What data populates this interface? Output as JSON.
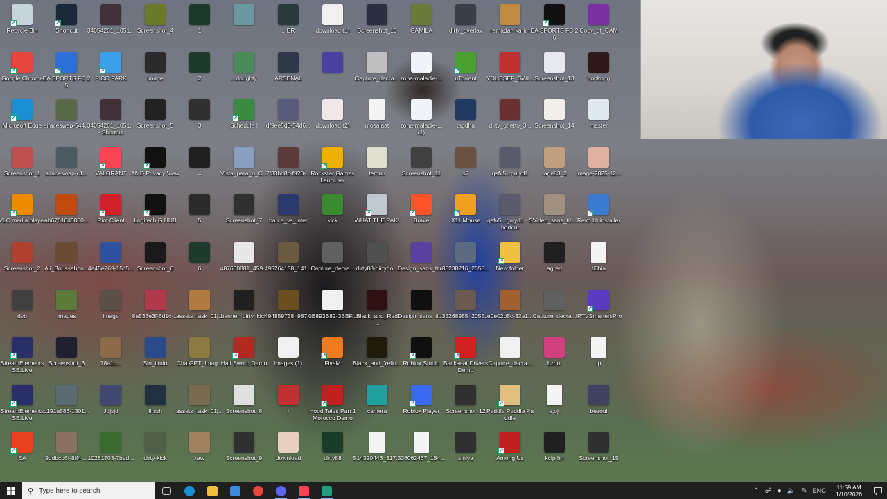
{
  "desktop": {
    "columns": [
      [
        {
          "label": "Recycle Bin",
          "icon": "recycle-bin-icon",
          "color": "#c8d4dc"
        },
        {
          "label": "Google Chrome",
          "icon": "chrome-icon",
          "color": "#e8453c"
        },
        {
          "label": "Microsoft Edge",
          "icon": "edge-icon",
          "color": "#1b8fd4"
        },
        {
          "label": "Screenshot_1",
          "icon": "image-icon",
          "color": "#c05050"
        },
        {
          "label": "VLC media player",
          "icon": "vlc-icon",
          "color": "#f08a00"
        },
        {
          "label": "Screenshot_2",
          "icon": "image-icon",
          "color": "#b04030"
        },
        {
          "label": "dvb",
          "icon": "image-icon",
          "color": "#404040"
        },
        {
          "label": "StreamElements SE.Live",
          "icon": "streamelements-icon",
          "color": "#2a2f6a"
        },
        {
          "label": "StreamElements SE.Live",
          "icon": "streamelements-icon",
          "color": "#2a2f6a"
        },
        {
          "label": "EA",
          "icon": "ea-icon",
          "color": "#e8411e"
        }
      ],
      [
        {
          "label": "Shortcut",
          "icon": "steam-icon",
          "color": "#1b2838"
        },
        {
          "label": "EA SPORTS FC 25",
          "icon": "eafc-icon",
          "color": "#2c6fd6"
        },
        {
          "label": "aifaceswap-544...",
          "icon": "image-icon",
          "color": "#5a6a48"
        },
        {
          "label": "aifaceswap-c1...",
          "icon": "image-icon",
          "color": "#4a5a60"
        },
        {
          "label": "ab67616d0000...",
          "icon": "image-icon",
          "color": "#c04a10"
        },
        {
          "label": "Ali_Boussabou...",
          "icon": "image-icon",
          "color": "#6a4a30"
        },
        {
          "label": "images",
          "icon": "image-icon",
          "color": "#5c7a3a"
        },
        {
          "label": "Screenshot_3",
          "icon": "image-icon",
          "color": "#202030"
        },
        {
          "label": "c191a586-1301...",
          "icon": "image-icon",
          "color": "#5a6a70"
        },
        {
          "label": "9ddbcb6f-8ff4-...",
          "icon": "image-icon",
          "color": "#8a7060"
        }
      ],
      [
        {
          "label": "34054261_1051...",
          "icon": "image-icon",
          "color": "#403038"
        },
        {
          "label": "PICO PARK",
          "icon": "picopark-icon",
          "color": "#3aa0e8"
        },
        {
          "label": "34054261_1051... - Shortcut",
          "icon": "image-icon",
          "color": "#403038"
        },
        {
          "label": "VALORANT",
          "icon": "valorant-icon",
          "color": "#fa4454"
        },
        {
          "label": "Riot Client",
          "icon": "riot-icon",
          "color": "#d0202a"
        },
        {
          "label": "4a45e769-15c5...",
          "icon": "image-icon",
          "color": "#3050a0"
        },
        {
          "label": "image",
          "icon": "image-icon",
          "color": "#5a5048"
        },
        {
          "label": "78a1c...",
          "icon": "image-icon",
          "color": "#8a6a4a"
        },
        {
          "label": "Jdjsjd",
          "icon": "image-icon",
          "color": "#404870"
        },
        {
          "label": "10281703-7bad...",
          "icon": "image-icon",
          "color": "#3a6a30"
        }
      ],
      [
        {
          "label": "Screenshot_4",
          "icon": "image-icon",
          "color": "#6a7a2a"
        },
        {
          "label": "image",
          "icon": "image-icon",
          "color": "#2a2a2a"
        },
        {
          "label": "Screenshot_5",
          "icon": "image-icon",
          "color": "#222222"
        },
        {
          "label": "AMD Privacy View",
          "icon": "amd-icon",
          "color": "#111111"
        },
        {
          "label": "Logitech G HUB",
          "icon": "logitech-icon",
          "color": "#111111"
        },
        {
          "label": "Screenshot_6",
          "icon": "image-icon",
          "color": "#1a1a1a"
        },
        {
          "label": "8a533e3f-6d1c-...",
          "icon": "image-icon",
          "color": "#b03a4a"
        },
        {
          "label": "Sin_titulo",
          "icon": "image-icon",
          "color": "#2a4a8a"
        },
        {
          "label": "finish",
          "icon": "image-icon",
          "color": "#203040"
        },
        {
          "label": "dirty-kick",
          "icon": "image-icon",
          "color": "#506048"
        }
      ],
      [
        {
          "label": "1",
          "icon": "image-icon",
          "color": "#1c3a2a"
        },
        {
          "label": "2",
          "icon": "image-icon",
          "color": "#1c3a2a"
        },
        {
          "label": "3",
          "icon": "image-icon",
          "color": "#303030"
        },
        {
          "label": "4",
          "icon": "image-icon",
          "color": "#202020"
        },
        {
          "label": "5",
          "icon": "image-icon",
          "color": "#2a2a2a"
        },
        {
          "label": "6",
          "icon": "image-icon",
          "color": "#1e3a2a"
        },
        {
          "label": "assets_task_01j...",
          "icon": "image-icon",
          "color": "#b07a40"
        },
        {
          "label": "ChatGPT_Imag...",
          "icon": "image-icon",
          "color": "#8a7a40"
        },
        {
          "label": "assets_task_01j...",
          "icon": "image-icon",
          "color": "#7a6a50"
        },
        {
          "label": "raw",
          "icon": "image-icon",
          "color": "#a08060"
        }
      ],
      [
        {
          "label": "",
          "icon": "image-icon",
          "color": "#6a9aa0"
        },
        {
          "label": "...doughty",
          "icon": "image-icon",
          "color": "#4a8a5a"
        },
        {
          "label": "Schedule I",
          "icon": "schedule-icon",
          "color": "#3a8a40"
        },
        {
          "label": "Vista_para_o_C...",
          "icon": "image-icon",
          "color": "#8aa0c0"
        },
        {
          "label": "Screenshot_7",
          "icon": "image-icon",
          "color": "#303030"
        },
        {
          "label": "487600881_459...",
          "icon": "image-icon",
          "color": "#e8e8e8"
        },
        {
          "label": "banner_dirty_kick",
          "icon": "image-icon",
          "color": "#202020"
        },
        {
          "label": "Half Sword Demo",
          "icon": "halfsword-icon",
          "color": "#b02a20"
        },
        {
          "label": "Screenshot_8",
          "icon": "image-icon",
          "color": "#e0e0e0"
        },
        {
          "label": "Screenshot_9",
          "icon": "image-icon",
          "color": "#303030"
        }
      ],
      [
        {
          "label": "...ER",
          "icon": "image-icon",
          "color": "#2a3a3a"
        },
        {
          "label": "ARSENAL",
          "icon": "image-icon",
          "color": "#303848"
        },
        {
          "label": "df9ee5d5-54d6...",
          "icon": "image-icon",
          "color": "#5a5a7a"
        },
        {
          "label": "7f33bd8c-f920-...",
          "icon": "image-icon",
          "color": "#5a3a3a"
        },
        {
          "label": "barca_vs_inter",
          "icon": "image-icon",
          "color": "#2a3a6a"
        },
        {
          "label": "495264158_141...",
          "icon": "image-icon",
          "color": "#6a5a40"
        },
        {
          "label": "494859738_987...",
          "icon": "image-icon",
          "color": "#6a5020"
        },
        {
          "label": "images (1)",
          "icon": "image-icon",
          "color": "#f0f0f0"
        },
        {
          "label": "i",
          "icon": "image-icon",
          "color": "#c03030"
        },
        {
          "label": "download",
          "icon": "image-icon",
          "color": "#e8d0c0"
        }
      ],
      [
        {
          "label": "download (1)",
          "icon": "image-icon",
          "color": "#f0f0f0"
        },
        {
          "label": "",
          "icon": "image-icon",
          "color": "#4a40a0"
        },
        {
          "label": "download (2)",
          "icon": "image-icon",
          "color": "#f0e8e8"
        },
        {
          "label": "Rockstar Games Launcher",
          "icon": "rockstar-icon",
          "color": "#f0b000"
        },
        {
          "label": "kick",
          "icon": "image-icon",
          "color": "#3a8a30"
        },
        {
          "label": "Capture_decra...",
          "icon": "image-icon",
          "color": "#606060"
        },
        {
          "label": "0B893B82-3BBF...",
          "icon": "image-icon",
          "color": "#f0f0f0"
        },
        {
          "label": "FiveM",
          "icon": "fivem-icon",
          "color": "#f07a20"
        },
        {
          "label": "Hood Tales Part 1 Morocco Demo",
          "icon": "hoodtales-icon",
          "color": "#c02020"
        },
        {
          "label": "dirty88",
          "icon": "image-icon",
          "color": "#1a3a2a"
        }
      ],
      [
        {
          "label": "Screenshot_10",
          "icon": "image-icon",
          "color": "#2a3040"
        },
        {
          "label": "Capture_decra...",
          "icon": "image-icon",
          "color": "#c0c0c0"
        },
        {
          "label": "mosalaat",
          "icon": "file-icon",
          "color": "#f4f4f4"
        },
        {
          "label": "temuu",
          "icon": "image-icon",
          "color": "#e0e0d0"
        },
        {
          "label": "WHAT THE PAK!",
          "icon": "whatthepak-icon",
          "color": "#c0c8d0"
        },
        {
          "label": "dirty88-dirtyho...",
          "icon": "image-icon",
          "color": "#505050"
        },
        {
          "label": "Black_and_Red_...",
          "icon": "image-icon",
          "color": "#301010"
        },
        {
          "label": "Black_and_Yello...",
          "icon": "image-icon",
          "color": "#201a08"
        },
        {
          "label": "camera",
          "icon": "image-icon",
          "color": "#20a0a0"
        },
        {
          "label": "514320446_317...",
          "icon": "file-icon",
          "color": "#f4f4f4"
        }
      ],
      [
        {
          "label": "GAMILA",
          "icon": "image-icon",
          "color": "#6a7a3a"
        },
        {
          "label": "zona-maladie-...",
          "icon": "image-icon",
          "color": "#f0f4f8"
        },
        {
          "label": "zona-maladie-... (1)",
          "icon": "image-icon",
          "color": "#f0f4f8"
        },
        {
          "label": "Screenshot_11",
          "icon": "image-icon",
          "color": "#404040"
        },
        {
          "label": "Brave",
          "icon": "brave-icon",
          "color": "#fb542b"
        },
        {
          "label": "Design_sans_titre",
          "icon": "image-icon",
          "color": "#5a40a0"
        },
        {
          "label": "Design_sans_tit...",
          "icon": "image-icon",
          "color": "#101010"
        },
        {
          "label": "Roblox Studio",
          "icon": "robloxstudio-icon",
          "color": "#101010"
        },
        {
          "label": "Roblox Player",
          "icon": "roblox-icon",
          "color": "#3a6af0"
        },
        {
          "label": "536062467_184...",
          "icon": "file-icon",
          "color": "#f4f4f4"
        }
      ],
      [
        {
          "label": "dirty_overlay",
          "icon": "image-icon",
          "color": "#3a4048"
        },
        {
          "label": "uTorrent",
          "icon": "utorrent-icon",
          "color": "#4aa030"
        },
        {
          "label": "tagdha",
          "icon": "image-icon",
          "color": "#203a60"
        },
        {
          "label": "s7",
          "icon": "image-icon",
          "color": "#6a5040"
        },
        {
          "label": "X11 Mouse",
          "icon": "mouse-icon",
          "color": "#f0a020"
        },
        {
          "label": "35238216_2055...",
          "icon": "image-icon",
          "color": "#5a6a80"
        },
        {
          "label": "35268955_2055...",
          "icon": "image-icon",
          "color": "#6a5a50"
        },
        {
          "label": "Backseat Drivers Demo",
          "icon": "backseat-icon",
          "color": "#d02020"
        },
        {
          "label": "Screenshot_12",
          "icon": "image-icon",
          "color": "#303030"
        },
        {
          "label": "siniya",
          "icon": "image-icon",
          "color": "#303030"
        }
      ],
      [
        {
          "label": "ramadan karim",
          "icon": "image-icon",
          "color": "#c08a40"
        },
        {
          "label": "YOUSSEF_SWI...",
          "icon": "image-icon",
          "color": "#c03030"
        },
        {
          "label": "dirty_ghetto_3...",
          "icon": "image-icon",
          "color": "#6a3030"
        },
        {
          "label": "qsfv5...gujyd1",
          "icon": "image-icon",
          "color": "#5a5a6a"
        },
        {
          "label": "qsfv5...gujyd1 - Shortcut",
          "icon": "image-icon",
          "color": "#5a5a6a"
        },
        {
          "label": "New folder",
          "icon": "folder-icon",
          "color": "#f0c040"
        },
        {
          "label": "e0e02b5c-32e1...",
          "icon": "image-icon",
          "color": "#a06030"
        },
        {
          "label": "Capture_decra...",
          "icon": "image-icon",
          "color": "#f0f0f0"
        },
        {
          "label": "Paddle Paddle Paddle",
          "icon": "paddle-icon",
          "color": "#e0c080"
        },
        {
          "label": "Among Us",
          "icon": "amongus-icon",
          "color": "#c02020"
        }
      ],
      [
        {
          "label": "EA SPORTS FC 26",
          "icon": "eafc-icon",
          "color": "#101010"
        },
        {
          "label": "Screenshot_13",
          "icon": "image-icon",
          "color": "#e8e8f0"
        },
        {
          "label": "Screenshot_14",
          "icon": "image-icon",
          "color": "#f0f0e8"
        },
        {
          "label": "rage83_2",
          "icon": "image-icon",
          "color": "#c0a080"
        },
        {
          "label": "Video_sans_tit...",
          "icon": "image-icon",
          "color": "#a09080"
        },
        {
          "label": "agred",
          "icon": "image-icon",
          "color": "#202020"
        },
        {
          "label": "Capture_decra...",
          "icon": "image-icon",
          "color": "#606060"
        },
        {
          "label": "bzoul",
          "icon": "image-icon",
          "color": "#d04080"
        },
        {
          "label": "e;oji",
          "icon": "file-icon",
          "color": "#f4f4f4"
        },
        {
          "label": "kcip hh",
          "icon": "image-icon",
          "color": "#202020"
        }
      ],
      [
        {
          "label": "Copy_of_CAM",
          "icon": "image-icon",
          "color": "#7a30a0"
        },
        {
          "label": "honkong",
          "icon": "image-icon",
          "color": "#301818"
        },
        {
          "label": "master",
          "icon": "image-icon",
          "color": "#e0e8f0"
        },
        {
          "label": "image-2025-12...",
          "icon": "image-icon",
          "color": "#e0b0a0"
        },
        {
          "label": "Revo Uninstaller",
          "icon": "revo-icon",
          "color": "#3a7ad0"
        },
        {
          "label": "ti3bia",
          "icon": "file-icon",
          "color": "#f4f4f4"
        },
        {
          "label": "IPTVSmartersPro",
          "icon": "iptv-icon",
          "color": "#5a3ac0"
        },
        {
          "label": "ip",
          "icon": "file-icon",
          "color": "#f4f4f4"
        },
        {
          "label": "bezoul",
          "icon": "image-icon",
          "color": "#404060"
        },
        {
          "label": "Screenshot_15",
          "icon": "image-icon",
          "color": "#303030"
        }
      ]
    ]
  },
  "taskbar": {
    "search_placeholder": "Type here to search",
    "pinned": [
      {
        "name": "task-view-button",
        "color": "#cccccc"
      },
      {
        "name": "edge-taskbar-button",
        "color": "#1b8fd4"
      },
      {
        "name": "file-explorer-taskbar-button",
        "color": "#f0c040"
      },
      {
        "name": "store-taskbar-button",
        "color": "#3a8ae0"
      },
      {
        "name": "chrome-taskbar-button",
        "color": "#e8453c"
      },
      {
        "name": "discord-taskbar-button",
        "color": "#5865f2"
      },
      {
        "name": "valorant-taskbar-button",
        "color": "#fa4454"
      },
      {
        "name": "obs-taskbar-button",
        "color": "#20a080"
      }
    ],
    "language": "ENG",
    "time": "11:59 AM",
    "date": "1/10/2026"
  }
}
